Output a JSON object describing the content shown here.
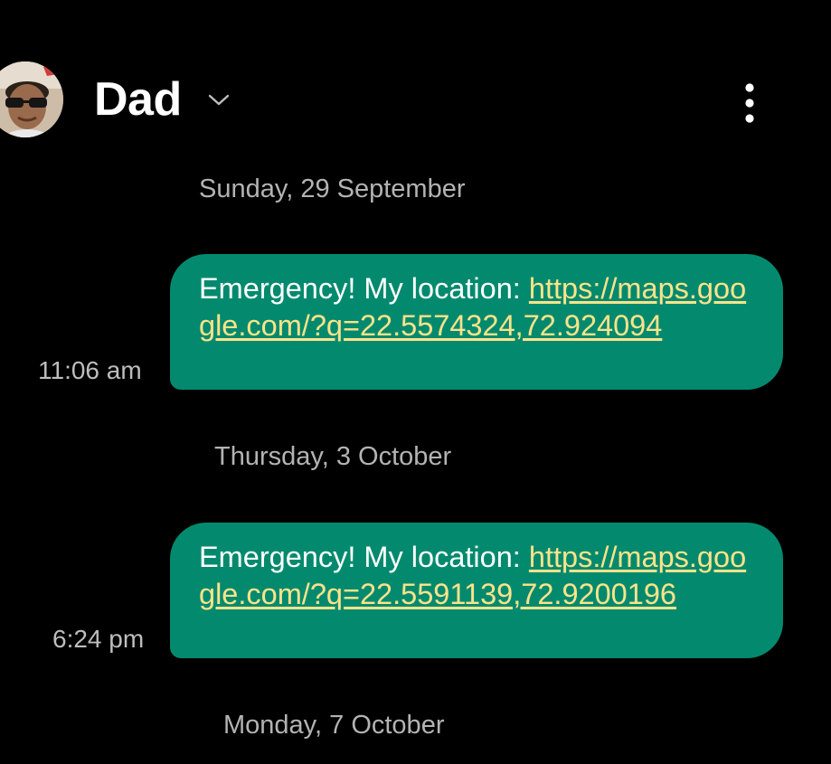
{
  "header": {
    "contact_name": "Dad",
    "chevron_icon": "chevron-down-icon",
    "more_icon": "more-vertical-icon"
  },
  "conversation": [
    {
      "date": "Sunday, 29 September",
      "message": {
        "prefix": "Emergency! My location: ",
        "link": "https://maps.google.com/?q=22.5574324,72.924094",
        "time": "11:06 am"
      }
    },
    {
      "date": "Thursday, 3 October",
      "message": {
        "prefix": "Emergency! My location: ",
        "link": "https://maps.google.com/?q=22.5591139,72.9200196",
        "time": "6:24 pm"
      }
    },
    {
      "date": "Monday, 7 October"
    }
  ],
  "colors": {
    "background": "#000000",
    "bubble": "#038a6e",
    "link": "#ffe38a",
    "date_text": "#b3b3b3",
    "time_text": "#bdbdbd"
  }
}
